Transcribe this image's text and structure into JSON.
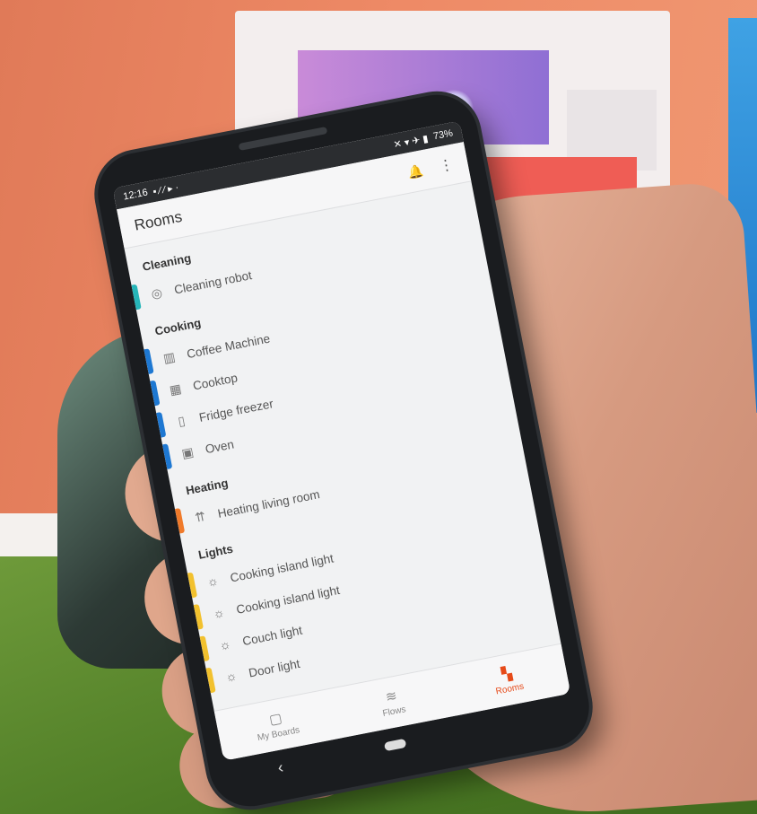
{
  "status_bar": {
    "time": "12:16",
    "battery": "73%"
  },
  "app_bar": {
    "title": "Rooms",
    "notification_icon": "bell-icon",
    "menu_icon": "more-vert-icon"
  },
  "sections": [
    {
      "name": "Cleaning",
      "items": [
        {
          "label": "Cleaning robot",
          "icon": "robot-icon",
          "color": "#26b5b8"
        }
      ]
    },
    {
      "name": "Cooking",
      "items": [
        {
          "label": "Coffee Machine",
          "icon": "coffee-machine-icon",
          "color": "#1e78d2"
        },
        {
          "label": "Cooktop",
          "icon": "cooktop-icon",
          "color": "#1e78d2"
        },
        {
          "label": "Fridge freezer",
          "icon": "fridge-icon",
          "color": "#1e78d2"
        },
        {
          "label": "Oven",
          "icon": "oven-icon",
          "color": "#1e78d2"
        }
      ]
    },
    {
      "name": "Heating",
      "items": [
        {
          "label": "Heating living room",
          "icon": "heating-icon",
          "color": "#f07a2a"
        }
      ]
    },
    {
      "name": "Lights",
      "items": [
        {
          "label": "Cooking island light",
          "icon": "bulb-icon",
          "color": "#f2c12e"
        },
        {
          "label": "Cooking island light",
          "icon": "bulb-icon",
          "color": "#f2c12e"
        },
        {
          "label": "Couch light",
          "icon": "bulb-icon",
          "color": "#f2c12e"
        },
        {
          "label": "Door light",
          "icon": "bulb-icon",
          "color": "#f2c12e"
        }
      ]
    }
  ],
  "bottom_nav": [
    {
      "label": "My Boards",
      "icon": "board-icon",
      "active": false
    },
    {
      "label": "Flows",
      "icon": "flows-icon",
      "active": false
    },
    {
      "label": "Rooms",
      "icon": "rooms-icon",
      "active": true
    }
  ],
  "accent_color": "#e64a19"
}
